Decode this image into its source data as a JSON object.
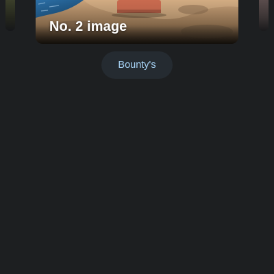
{
  "carousel": {
    "current_caption": "No. 2 image"
  },
  "chip": {
    "label": "Bounty's"
  }
}
